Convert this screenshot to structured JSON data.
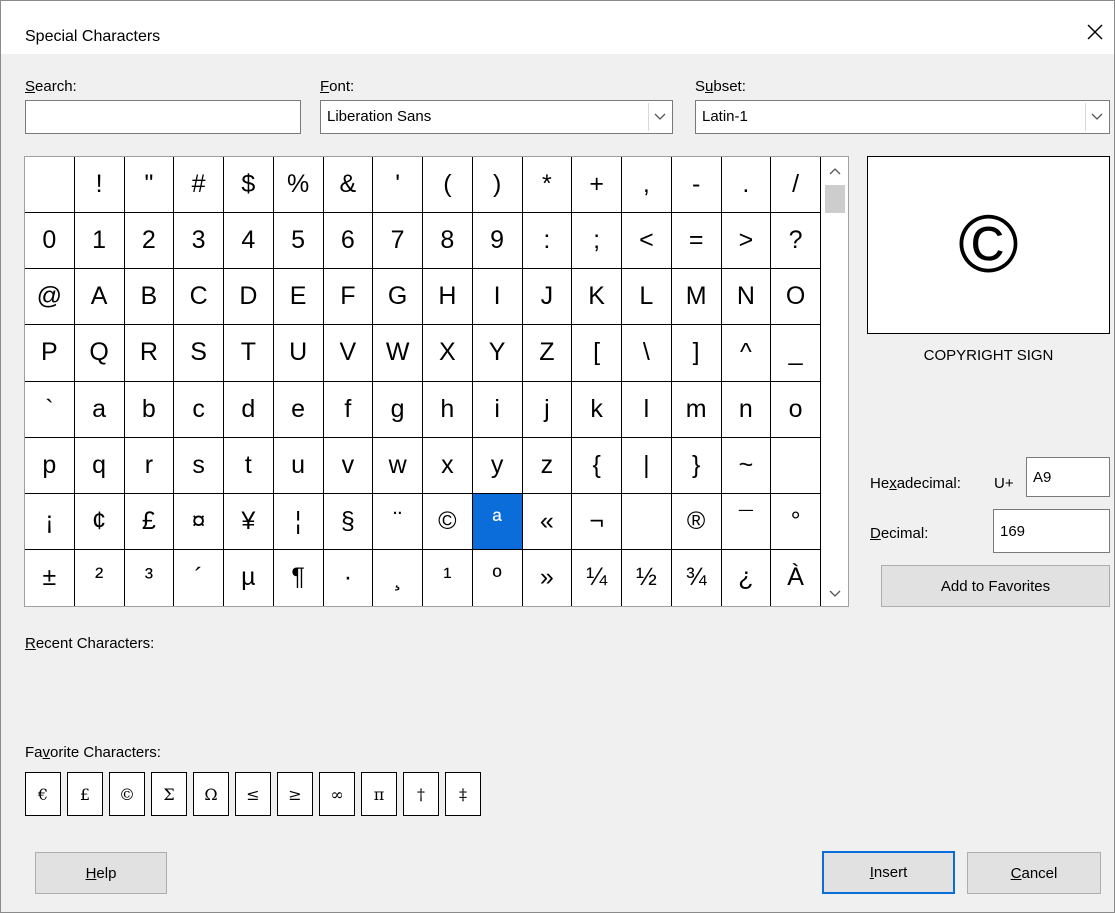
{
  "window": {
    "title": "Special Characters"
  },
  "search": {
    "label_u": "S",
    "label_rest": "earch:",
    "value": ""
  },
  "font": {
    "label_u": "F",
    "label_rest": "ont:",
    "value": "Liberation Sans"
  },
  "subset": {
    "label_pre": "S",
    "label_u": "u",
    "label_rest": "bset:",
    "value": "Latin-1"
  },
  "grid": {
    "selected_index": 105,
    "chars": [
      " ",
      "!",
      "\"",
      "#",
      "$",
      "%",
      "&",
      "'",
      "(",
      ")",
      "*",
      "+",
      ",",
      "-",
      ".",
      "/",
      "0",
      "1",
      "2",
      "3",
      "4",
      "5",
      "6",
      "7",
      "8",
      "9",
      ":",
      ";",
      "<",
      "=",
      ">",
      "?",
      "@",
      "A",
      "B",
      "C",
      "D",
      "E",
      "F",
      "G",
      "H",
      "I",
      "J",
      "K",
      "L",
      "M",
      "N",
      "O",
      "P",
      "Q",
      "R",
      "S",
      "T",
      "U",
      "V",
      "W",
      "X",
      "Y",
      "Z",
      "[",
      "\\",
      "]",
      "^",
      "_",
      "`",
      "a",
      "b",
      "c",
      "d",
      "e",
      "f",
      "g",
      "h",
      "i",
      "j",
      "k",
      "l",
      "m",
      "n",
      "o",
      "p",
      "q",
      "r",
      "s",
      "t",
      "u",
      "v",
      "w",
      "x",
      "y",
      "z",
      "{",
      "|",
      "}",
      "~",
      " ",
      "¡",
      "¢",
      "£",
      "¤",
      "¥",
      "¦",
      "§",
      "¨",
      "©",
      "ª",
      "«",
      "¬",
      " ",
      "®",
      "¯",
      "°",
      "±",
      "²",
      "³",
      "´",
      "µ",
      "¶",
      "·",
      "¸",
      "¹",
      "º",
      "»",
      "¼",
      "½",
      "¾",
      "¿",
      "À"
    ]
  },
  "preview": {
    "char": "©",
    "name": "COPYRIGHT SIGN"
  },
  "hexadecimal": {
    "label_pre": "He",
    "label_u": "x",
    "label_rest": "adecimal:",
    "prefix": "U+",
    "value": "A9"
  },
  "decimal": {
    "label_u": "D",
    "label_rest": "ecimal:",
    "value": "169"
  },
  "add_favorites": {
    "label": "Add to Favorites"
  },
  "recent": {
    "label_u": "R",
    "label_rest": "ecent Characters:"
  },
  "favorites": {
    "label_pre": "Fa",
    "label_u": "v",
    "label_rest": "orite Characters:",
    "chars": [
      "€",
      "£",
      "©",
      "Σ",
      "Ω",
      "≤",
      "≥",
      "∞",
      "π",
      "†",
      "‡"
    ]
  },
  "buttons": {
    "help_u": "H",
    "help_rest": "elp",
    "insert_u": "I",
    "insert_rest": "nsert",
    "cancel_u": "C",
    "cancel_rest": "ancel"
  },
  "colors": {
    "selection": "#0a6dd9",
    "dialog_bg": "#f0f0f0",
    "button_bg": "#e1e1e1"
  }
}
